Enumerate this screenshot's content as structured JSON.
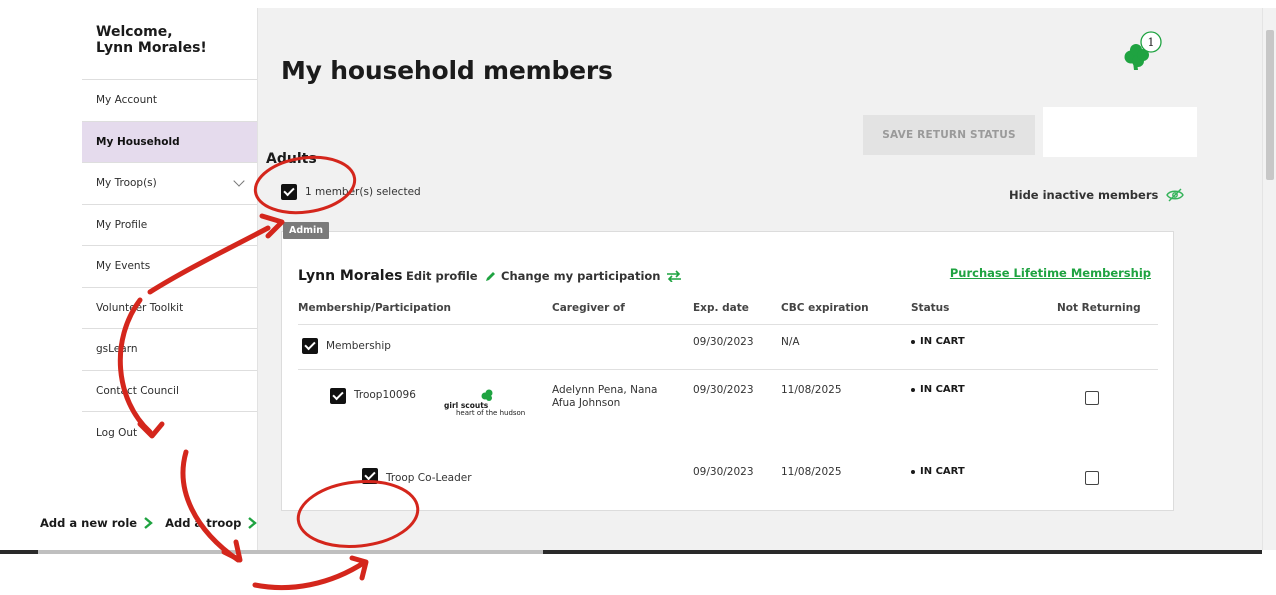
{
  "sidebar": {
    "welcome_line1": "Welcome,",
    "welcome_line2": "Lynn Morales!",
    "items": [
      {
        "label": "My Account"
      },
      {
        "label": "My Household"
      },
      {
        "label": "My Troop(s)"
      },
      {
        "label": "My Profile"
      },
      {
        "label": "My Events"
      },
      {
        "label": "Volunteer Toolkit"
      },
      {
        "label": "gsLearn"
      },
      {
        "label": "Contact Council"
      },
      {
        "label": "Log Out"
      }
    ]
  },
  "header": {
    "title": "My household members",
    "notification_count": "1",
    "save_button": "SAVE RETURN STATUS"
  },
  "adults": {
    "heading": "Adults",
    "selected_text": "1 member(s) selected",
    "hide_inactive": "Hide inactive members"
  },
  "member": {
    "badge": "Admin",
    "name": "Lynn Morales",
    "edit_profile": "Edit profile",
    "change_participation": "Change my participation",
    "purchase_link": "Purchase Lifetime Membership",
    "columns": [
      "Membership/Participation",
      "Caregiver of",
      "Exp. date",
      "CBC expiration",
      "Status",
      "Not Returning"
    ],
    "rows": [
      {
        "label": "Membership",
        "caregiver": "",
        "exp": "09/30/2023",
        "cbc": "N/A",
        "status": "IN CART"
      },
      {
        "label": "Troop10096",
        "caregiver_line1": "Adelynn Pena, Nana",
        "caregiver_line2": "Afua Johnson",
        "exp": "09/30/2023",
        "cbc": "11/08/2025",
        "status": "IN CART"
      },
      {
        "label": "Troop Co-Leader",
        "caregiver": "",
        "exp": "09/30/2023",
        "cbc": "11/08/2025",
        "status": "IN CART"
      }
    ],
    "council_logo_line1": "girl scouts",
    "council_logo_line2": "heart of the hudson"
  },
  "actions": {
    "add_role": "Add a new role",
    "add_troop": "Add a troop"
  },
  "colors": {
    "accent_green": "#1fa341",
    "active_nav": "#e5dbed",
    "annotation_red": "#d4261c"
  }
}
